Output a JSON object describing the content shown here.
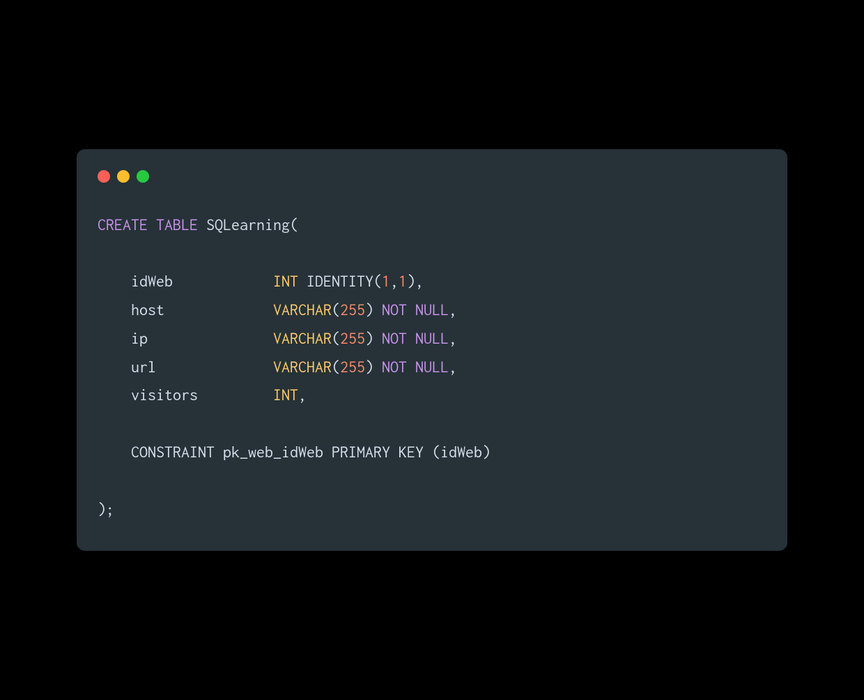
{
  "code": {
    "line1": {
      "create": "CREATE",
      "table": "TABLE",
      "name": "SQLearning("
    },
    "cols": [
      {
        "name": "idWeb",
        "pad": "            ",
        "type": "INT",
        "extra_text": " IDENTITY(",
        "num1": "1",
        "comma1": ",",
        "num2": "1",
        "close": "),"
      },
      {
        "name": "host",
        "pad": "             ",
        "type": "VARCHAR",
        "open": "(",
        "num": "255",
        "close": ") ",
        "not": "NOT",
        "null": "NULL",
        "end": ","
      },
      {
        "name": "ip",
        "pad": "               ",
        "type": "VARCHAR",
        "open": "(",
        "num": "255",
        "close": ") ",
        "not": "NOT",
        "null": "NULL",
        "end": ","
      },
      {
        "name": "url",
        "pad": "              ",
        "type": "VARCHAR",
        "open": "(",
        "num": "255",
        "close": ") ",
        "not": "NOT",
        "null": "NULL",
        "end": ","
      },
      {
        "name": "visitors",
        "pad": "         ",
        "type": "INT",
        "end": ","
      }
    ],
    "constraint_line": "    CONSTRAINT pk_web_idWeb PRIMARY KEY (idWeb)",
    "closing": ");"
  }
}
